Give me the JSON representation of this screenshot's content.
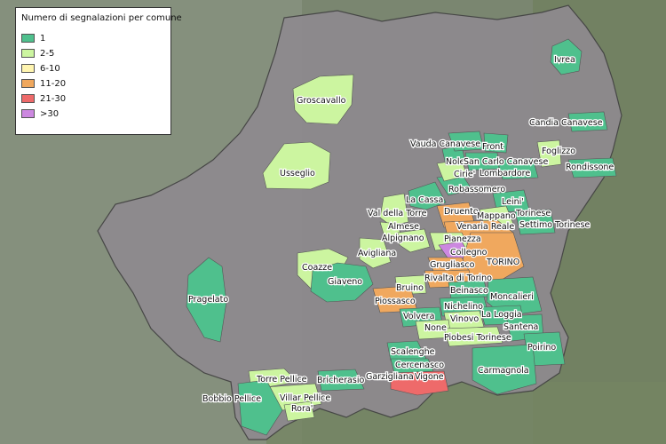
{
  "legend": {
    "title": "Numero di segnalazioni per comune",
    "items": [
      {
        "label": "1",
        "color": "#4fc08d"
      },
      {
        "label": "2-5",
        "color": "#ccf5a0"
      },
      {
        "label": "6-10",
        "color": "#fff5b0"
      },
      {
        "label": "11-20",
        "color": "#f0a85e"
      },
      {
        "label": "21-30",
        "color": "#ee6a6a"
      },
      {
        "label": ">30",
        "color": "#cc88e0"
      }
    ]
  },
  "comuni": [
    {
      "name": "Ivrea",
      "class": "1"
    },
    {
      "name": "Groscavallo",
      "class": "2-5"
    },
    {
      "name": "Candia Canavese",
      "class": "1"
    },
    {
      "name": "Foglizzo",
      "class": "2-5"
    },
    {
      "name": "Vauda Canavese",
      "class": "1"
    },
    {
      "name": "Front",
      "class": "1"
    },
    {
      "name": "Rondissone",
      "class": "1"
    },
    {
      "name": "Usseglio",
      "class": "2-5"
    },
    {
      "name": "Nole",
      "class": "1"
    },
    {
      "name": "San Carlo Canavese",
      "class": "1"
    },
    {
      "name": "Cirie'",
      "class": "2-5"
    },
    {
      "name": "Lombardore",
      "class": "1"
    },
    {
      "name": "Robassomero",
      "class": "1"
    },
    {
      "name": "La Cassa",
      "class": "1"
    },
    {
      "name": "Leini'",
      "class": "1"
    },
    {
      "name": "Druento",
      "class": "11-20"
    },
    {
      "name": "Torinese",
      "class": "1"
    },
    {
      "name": "Val della Torre",
      "class": "2-5"
    },
    {
      "name": "Mappano",
      "class": "2-5"
    },
    {
      "name": "Settimo Torinese",
      "class": "1"
    },
    {
      "name": "Almese",
      "class": "2-5"
    },
    {
      "name": "Venaria Reale",
      "class": "11-20"
    },
    {
      "name": "Alpignano",
      "class": "2-5"
    },
    {
      "name": "Pianezza",
      "class": "2-5"
    },
    {
      "name": "Collegno",
      "class": ">30"
    },
    {
      "name": "Avigliana",
      "class": "2-5"
    },
    {
      "name": "TORINO",
      "class": "11-20"
    },
    {
      "name": "Grugliasco",
      "class": "11-20"
    },
    {
      "name": "Coazze",
      "class": "2-5"
    },
    {
      "name": "Giaveno",
      "class": "1"
    },
    {
      "name": "Rivalta di Torino",
      "class": "11-20"
    },
    {
      "name": "Bruino",
      "class": "2-5"
    },
    {
      "name": "Beinasco",
      "class": "1"
    },
    {
      "name": "Moncalieri",
      "class": "1"
    },
    {
      "name": "Pragelato",
      "class": "1"
    },
    {
      "name": "Piossasco",
      "class": "11-20"
    },
    {
      "name": "Nichelino",
      "class": "1"
    },
    {
      "name": "Volvera",
      "class": "1"
    },
    {
      "name": "Vinovo",
      "class": "2-5"
    },
    {
      "name": "La Loggia",
      "class": "1"
    },
    {
      "name": "Santena",
      "class": "1"
    },
    {
      "name": "None",
      "class": "2-5"
    },
    {
      "name": "Piobesi Torinese",
      "class": "2-5"
    },
    {
      "name": "Poirino",
      "class": "1"
    },
    {
      "name": "Scalenghe",
      "class": "1"
    },
    {
      "name": "Cercenasco",
      "class": "1"
    },
    {
      "name": "Carmagnola",
      "class": "1"
    },
    {
      "name": "Torre Pellice",
      "class": "2-5"
    },
    {
      "name": "Bricherasio",
      "class": "1"
    },
    {
      "name": "Garzigliana",
      "class": "21-30"
    },
    {
      "name": "Vigone",
      "class": "21-30"
    },
    {
      "name": "Villar Pellice",
      "class": "2-5"
    },
    {
      "name": "Bobbio Pellice",
      "class": "1"
    },
    {
      "name": "Rora'",
      "class": "2-5"
    }
  ]
}
